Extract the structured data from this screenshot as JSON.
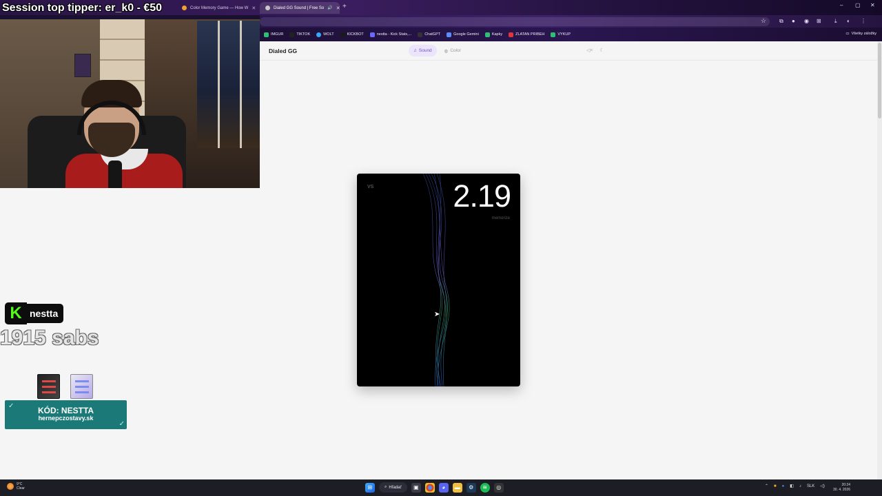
{
  "browser": {
    "tabs": [
      {
        "label": "",
        "color": "#7a6aa8"
      },
      {
        "label": "",
        "color": "#7a6aa8"
      },
      {
        "label": "Color Memory Game — How W",
        "color": "#f0a030"
      },
      {
        "label": "Dialed GG Sound | Free So",
        "color": "#c8c8c8"
      }
    ],
    "new_tab": "+",
    "window_controls": {
      "minimize": "–",
      "maximize": "▢",
      "close": "✕"
    },
    "bookmarks": [
      {
        "label": "IMGUR",
        "color": "#2fbf71"
      },
      {
        "label": "TIKTOK",
        "color": "#222222"
      },
      {
        "label": "WOLT",
        "color": "#35a7ff"
      },
      {
        "label": "KICKBOT",
        "color": "#1a1a1a"
      },
      {
        "label": "nestta - Kick Stats,...",
        "color": "#6a6aff"
      },
      {
        "label": "ChatGPT",
        "color": "#333333"
      },
      {
        "label": "Google Gemini",
        "color": "#5a8cff"
      },
      {
        "label": "Kapky",
        "color": "#2fbf71"
      },
      {
        "label": "ZLATAN PRIBEH",
        "color": "#e0353a"
      },
      {
        "label": "VYKUP",
        "color": "#2fbf71"
      }
    ],
    "bookmarks_folder": "Všetky záložky"
  },
  "site": {
    "brand": "Dialed GG",
    "tabs": [
      {
        "label": "Sound",
        "icon": "music-note-icon",
        "active": true
      },
      {
        "label": "Color",
        "icon": "palette-icon",
        "active": false
      }
    ],
    "card": {
      "logo": "VS",
      "score": "2.19",
      "mode": "memorize"
    }
  },
  "stream": {
    "top_tipper": "Session top tipper: er_k0 - €50",
    "channel": "nestta",
    "kick_letter": "K",
    "subs": "1915 sabs",
    "promo_code": "KÓD: NESTTA",
    "promo_site": "hernepczostavy.sk"
  },
  "taskbar": {
    "weather_temp": "9°C",
    "weather_desc": "Clear",
    "search": "Hľadať",
    "language": "SLK",
    "time": "20:24",
    "date": "30. 4. 2026"
  }
}
